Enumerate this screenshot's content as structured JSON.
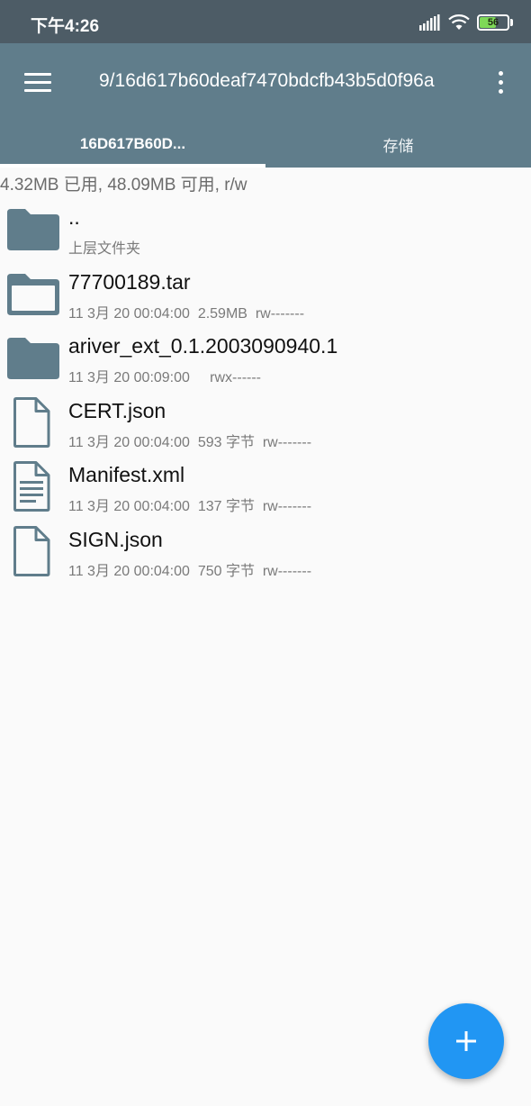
{
  "status_bar": {
    "time": "下午4:26",
    "battery": "56",
    "signal_icon": "signal-bars-icon",
    "wifi_icon": "wifi-icon",
    "battery_icon": "battery-icon"
  },
  "app_bar": {
    "title": "9/16d617b60deaf7470bdcfb43b5d0f96a",
    "menu_icon": "hamburger-menu-icon",
    "overflow_icon": "more-vert-icon"
  },
  "tabs": [
    {
      "label": "16D617B60D...",
      "active": true
    },
    {
      "label": "存储",
      "active": false
    }
  ],
  "storage_info": "4.32MB 已用, 48.09MB 可用, r/w",
  "files": [
    {
      "name": "..",
      "meta": "上层文件夹",
      "icon": "folder-filled-icon"
    },
    {
      "name": "77700189.tar",
      "meta": "11 3月 20 00:04:00  2.59MB  rw-------",
      "icon": "folder-outline-icon"
    },
    {
      "name": "ariver_ext_0.1.2003090940.1",
      "meta": "11 3月 20 00:09:00     rwx------",
      "icon": "folder-filled-icon"
    },
    {
      "name": "CERT.json",
      "meta": "11 3月 20 00:04:00  593 字节  rw-------",
      "icon": "file-icon"
    },
    {
      "name": "Manifest.xml",
      "meta": "11 3月 20 00:04:00  137 字节  rw-------",
      "icon": "text-file-icon"
    },
    {
      "name": "SIGN.json",
      "meta": "11 3月 20 00:04:00  750 字节  rw-------",
      "icon": "file-icon"
    }
  ],
  "fab": {
    "icon": "plus-icon"
  },
  "colors": {
    "status_bar": "#4d5c66",
    "app_bar": "#607d8b",
    "icon": "#607d8b",
    "fab": "#2196f3",
    "background": "#fafafa"
  }
}
